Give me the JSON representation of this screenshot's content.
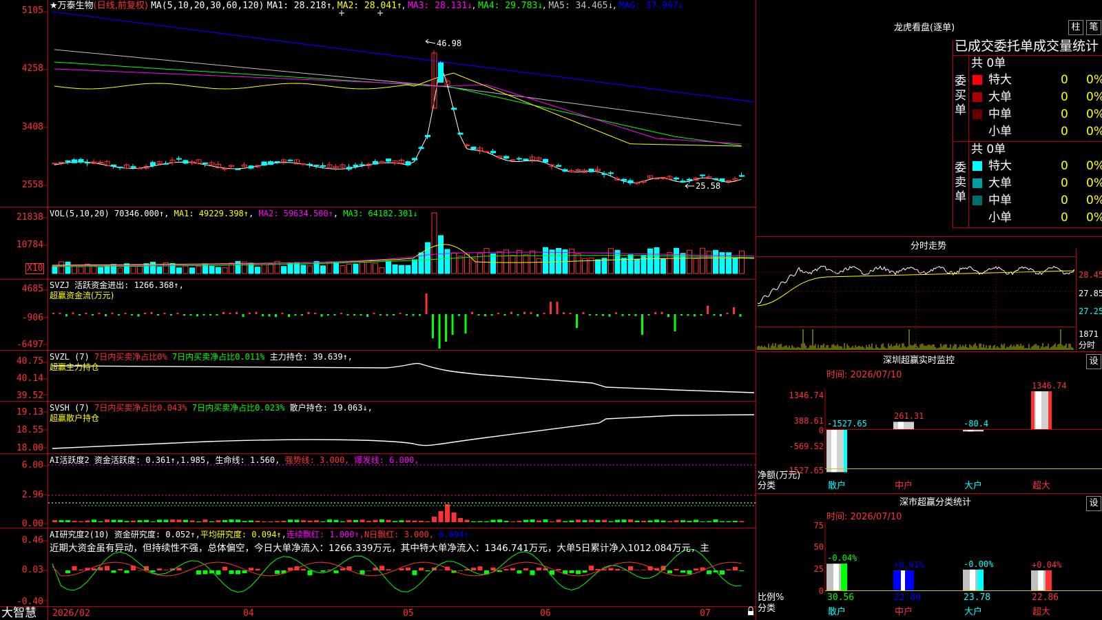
{
  "colors": {
    "up": "#ff3232",
    "down": "#00ffff",
    "ma1": "#ffffff",
    "ma2": "#ffff00",
    "ma3": "#ff00ff",
    "ma4": "#00ff00",
    "ma5": "#c0c0c0",
    "ma6": "#0000ff",
    "border": "#c00000",
    "label_red": "#ff3232"
  },
  "header": {
    "star": "★",
    "name": "万泰生物",
    "mode": "(日线,前复权)",
    "ma_label": "MA(5,10,20,30,60,120)",
    "ma_values": [
      "MA1: 28.218↑",
      "MA2: 28.041↑",
      "MA3: 28.131↓",
      "MA4: 29.783↓",
      "MA5: 34.465↓",
      "MA6: 37.967↓"
    ]
  },
  "price_axis": {
    "ticks": [
      "5105",
      "4258",
      "3408",
      "2558"
    ]
  },
  "price_annotations": {
    "high": "46.98",
    "low": "25.58"
  },
  "vol": {
    "header": "VOL(5,10,20)",
    "value": "70346.000↑",
    "ma1": "MA1: 49229.398↑",
    "ma2": "MA2: 59634.500↑",
    "ma3": "MA3: 64182.301↓",
    "ticks": [
      "21838",
      "10784"
    ],
    "unit": "X10"
  },
  "svzj": {
    "title": "SVZJ",
    "item": "活跃资金进出: 1266.368↑,",
    "subtitle": "超赢资金流(万元)",
    "ticks": [
      "4685",
      "-906",
      "-6497"
    ]
  },
  "svzl": {
    "title": "SVZL  (7)",
    "r1": "7日内买卖净占比0%",
    "r2": "7日内买卖净占比0.011%",
    "pos": "主力持仓: 39.639↑,",
    "subtitle": "超赢主力持仓",
    "ticks": [
      "40.75",
      "40.14",
      "39.52"
    ]
  },
  "svsh": {
    "title": "SVSH  (7)",
    "r1": "7日内买卖净占比0.043%",
    "r2": "7日内买卖净占比0.023%",
    "pos": "散户持仓: 19.063↓,",
    "subtitle": "超赢散户持仓",
    "ticks": [
      "19.13",
      "18.55",
      "18.00"
    ]
  },
  "ai_act": {
    "title": "AI活跃度2",
    "a": "资金活跃度: 0.361↑,",
    "b": "1.985,",
    "c": "生命线: 1.560,",
    "d": "强势线: 3.000,",
    "e": "爆发线: 6.000,",
    "ticks": [
      "6.00",
      "2.96",
      "0.00"
    ]
  },
  "ai_res": {
    "title": "AI研究度2(10)",
    "a": "资金研究度: 0.052↑,",
    "b": "平均研究度: 0.094↑,",
    "c": "连续飘红: 1.000↑,",
    "d": "N日飘红: 3.000,",
    "e": "0.094↑",
    "comment": "近期大资金虽有异动，但持续性不强，总体偏空，今日大单净流入：1266.339万元，其中特大单净流入：1346.741万元，大单5日累计净入1012.084万元，主",
    "ticks": [
      "0.46",
      "0.03",
      "-0.40"
    ]
  },
  "date_axis": {
    "brand": "大智慧",
    "labels": [
      "2026/02",
      "04",
      "05",
      "06",
      "07"
    ]
  },
  "longhu": {
    "title": "龙虎看盘(逐单)",
    "btn1": "柱",
    "btn2": "笔",
    "section": "已成交委托单成交量统计",
    "buy_label": "委买单",
    "sell_label": "委卖单",
    "buy_count": "共 0单",
    "sell_count": "共 0单",
    "buy_rows": [
      {
        "name": "特大",
        "v": "0",
        "p": "0%",
        "color": "#ff0000"
      },
      {
        "name": "大单",
        "v": "0",
        "p": "0%",
        "color": "#aa0000"
      },
      {
        "name": "中单",
        "v": "0",
        "p": "0%",
        "color": "#660000"
      },
      {
        "name": "小单",
        "v": "0",
        "p": "0%",
        "color": ""
      }
    ],
    "sell_rows": [
      {
        "name": "特大",
        "v": "0",
        "p": "0%",
        "color": "#00ffff"
      },
      {
        "name": "大单",
        "v": "0",
        "p": "0%",
        "color": "#00a0a0"
      },
      {
        "name": "中单",
        "v": "0",
        "p": "0%",
        "color": "#006e6e"
      },
      {
        "name": "小单",
        "v": "0",
        "p": "0%",
        "color": ""
      }
    ]
  },
  "fenshi": {
    "title": "分时走势",
    "ticks": [
      "28.45",
      "27.85",
      "27.25"
    ],
    "vol_tick": "1871",
    "vol_label": "分时"
  },
  "monitor": {
    "title": "深圳超赢实时监控",
    "btn": "设",
    "date": "时间: 2026/07/10",
    "ticks": [
      "1346.74",
      "388.61",
      "0",
      "-569.52",
      "-1527.65"
    ],
    "axis_label_1": "净额(万元)",
    "axis_label_2": "分类",
    "categories": [
      "散户",
      "中户",
      "大户",
      "超大"
    ]
  },
  "classify": {
    "title": "深市超赢分类统计",
    "btn": "设",
    "date": "时间: 2026/07/10",
    "ticks": [
      "75",
      "50",
      "25",
      "0"
    ],
    "axis_label_1": "比例%",
    "axis_label_2": "分类",
    "categories": [
      "散户",
      "中户",
      "大户",
      "超大"
    ]
  },
  "chart_data": [
    {
      "type": "bar",
      "title": "深圳超赢实时监控",
      "categories": [
        "散户",
        "中户",
        "大户",
        "超大"
      ],
      "values": [
        -1527.65,
        261.31,
        -80.4,
        1346.74
      ],
      "ylim": [
        -1527.65,
        1346.74
      ],
      "ylabel": "净额(万元)",
      "xlabel": "分类"
    },
    {
      "type": "bar",
      "title": "深市超赢分类统计",
      "categories": [
        "散户",
        "中户",
        "大户",
        "超大"
      ],
      "series": [
        {
          "values": [
            30.56,
            22.8,
            23.78,
            22.86
          ]
        },
        {
          "values": [
            -0.04,
            0.01,
            -0.0,
            0.04
          ]
        }
      ],
      "ylim": [
        0,
        75
      ],
      "ylabel": "比例%",
      "xlabel": "分类"
    }
  ]
}
